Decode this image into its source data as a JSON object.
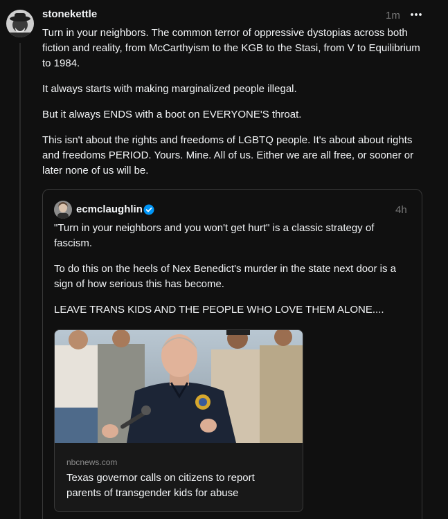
{
  "post": {
    "username": "stonekettle",
    "time": "1m",
    "paragraphs": [
      "Turn in your neighbors. The common terror of oppressive dystopias across both fiction and reality, from McCarthyism to the KGB to the Stasi, from V to Equilibrium to 1984.",
      "It always starts with making marginalized people illegal.",
      "But it always ENDS with a boot on EVERYONE'S throat.",
      "This isn't about the rights and freedoms of LGBTQ people. It's about about rights and freedoms PERIOD. Yours. Mine. All of us. Either we are all free, or sooner or later none of us will be."
    ],
    "more_icon": "more-horizontal-icon"
  },
  "quote": {
    "username": "ecmclaughlin",
    "verified_icon": "verified-badge-icon",
    "time": "4h",
    "paragraphs": [
      "\"Turn in your neighbors and you won't get hurt\" is a classic strategy of fascism.",
      "To do this on the heels of Nex Benedict's murder in the state next door is a sign of how serious this has become.",
      "LEAVE TRANS KIDS AND THE PEOPLE WHO LOVE THEM ALONE...."
    ],
    "link": {
      "domain": "nbcnews.com",
      "title": "Texas governor calls on citizens to report parents of transgender kids for abuse"
    }
  },
  "colors": {
    "background": "#101010",
    "text": "#f3f5f7",
    "muted": "#777777",
    "border": "#393939",
    "verified": "#0095f6"
  }
}
